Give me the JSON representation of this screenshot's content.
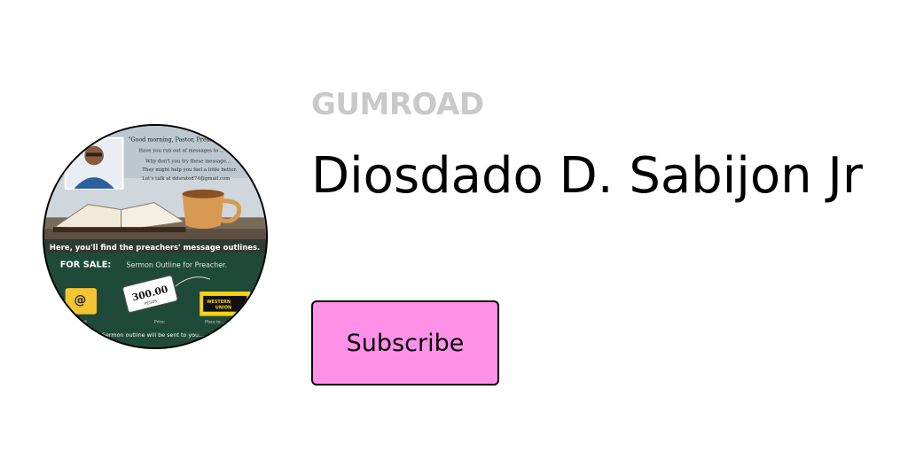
{
  "brand": {
    "logo_text": "GUMROAD"
  },
  "creator": {
    "name": "Diosdado D. Sabijon Jr"
  },
  "actions": {
    "subscribe_label": "Subscribe"
  },
  "avatar_image": {
    "greeting_lines": [
      "\"Good morning, Pastor, Preacher!",
      "Have you run out of messages to ...",
      "Why don't you try these message...",
      "They might help you feel a little better.",
      "Let's talk at ddsrated74@gmail.com"
    ],
    "banner_text": "Here, you'll find the preachers' message outlines.",
    "for_sale_label": "FOR SALE:",
    "for_sale_text": "Sermon Outline for Preacher.",
    "price_value": "300.00",
    "price_currency": "PESOS",
    "price_caption": "Price:",
    "email_caption": "Email",
    "wu_label_1": "WESTERN",
    "wu_label_2": "UNION",
    "wu_caption": "Place to...",
    "footer_text": "Sermon outline will be sent to you..."
  },
  "colors": {
    "brand_pink": "#ff90e8",
    "logo_gray": "#c9c9c9",
    "avatar_green": "#1f4a3a"
  }
}
